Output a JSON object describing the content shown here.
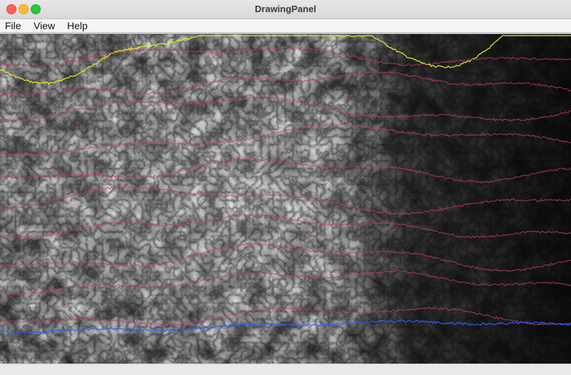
{
  "window": {
    "title": "DrawingPanel"
  },
  "menu": {
    "file": "File",
    "view": "View",
    "help": "Help"
  },
  "colors": {
    "close": "#fe5f57",
    "minimize": "#febc2e",
    "maximize": "#28c840",
    "path_default": "#c63a6e",
    "path_highlight": "#e6f020",
    "path_best": "#2b5cff"
  },
  "map": {
    "paths": [
      {
        "kind": "highlight"
      },
      {
        "kind": "default"
      },
      {
        "kind": "default"
      },
      {
        "kind": "default"
      },
      {
        "kind": "default"
      },
      {
        "kind": "default"
      },
      {
        "kind": "default"
      },
      {
        "kind": "default"
      },
      {
        "kind": "default"
      },
      {
        "kind": "default"
      },
      {
        "kind": "default"
      },
      {
        "kind": "best"
      }
    ]
  }
}
